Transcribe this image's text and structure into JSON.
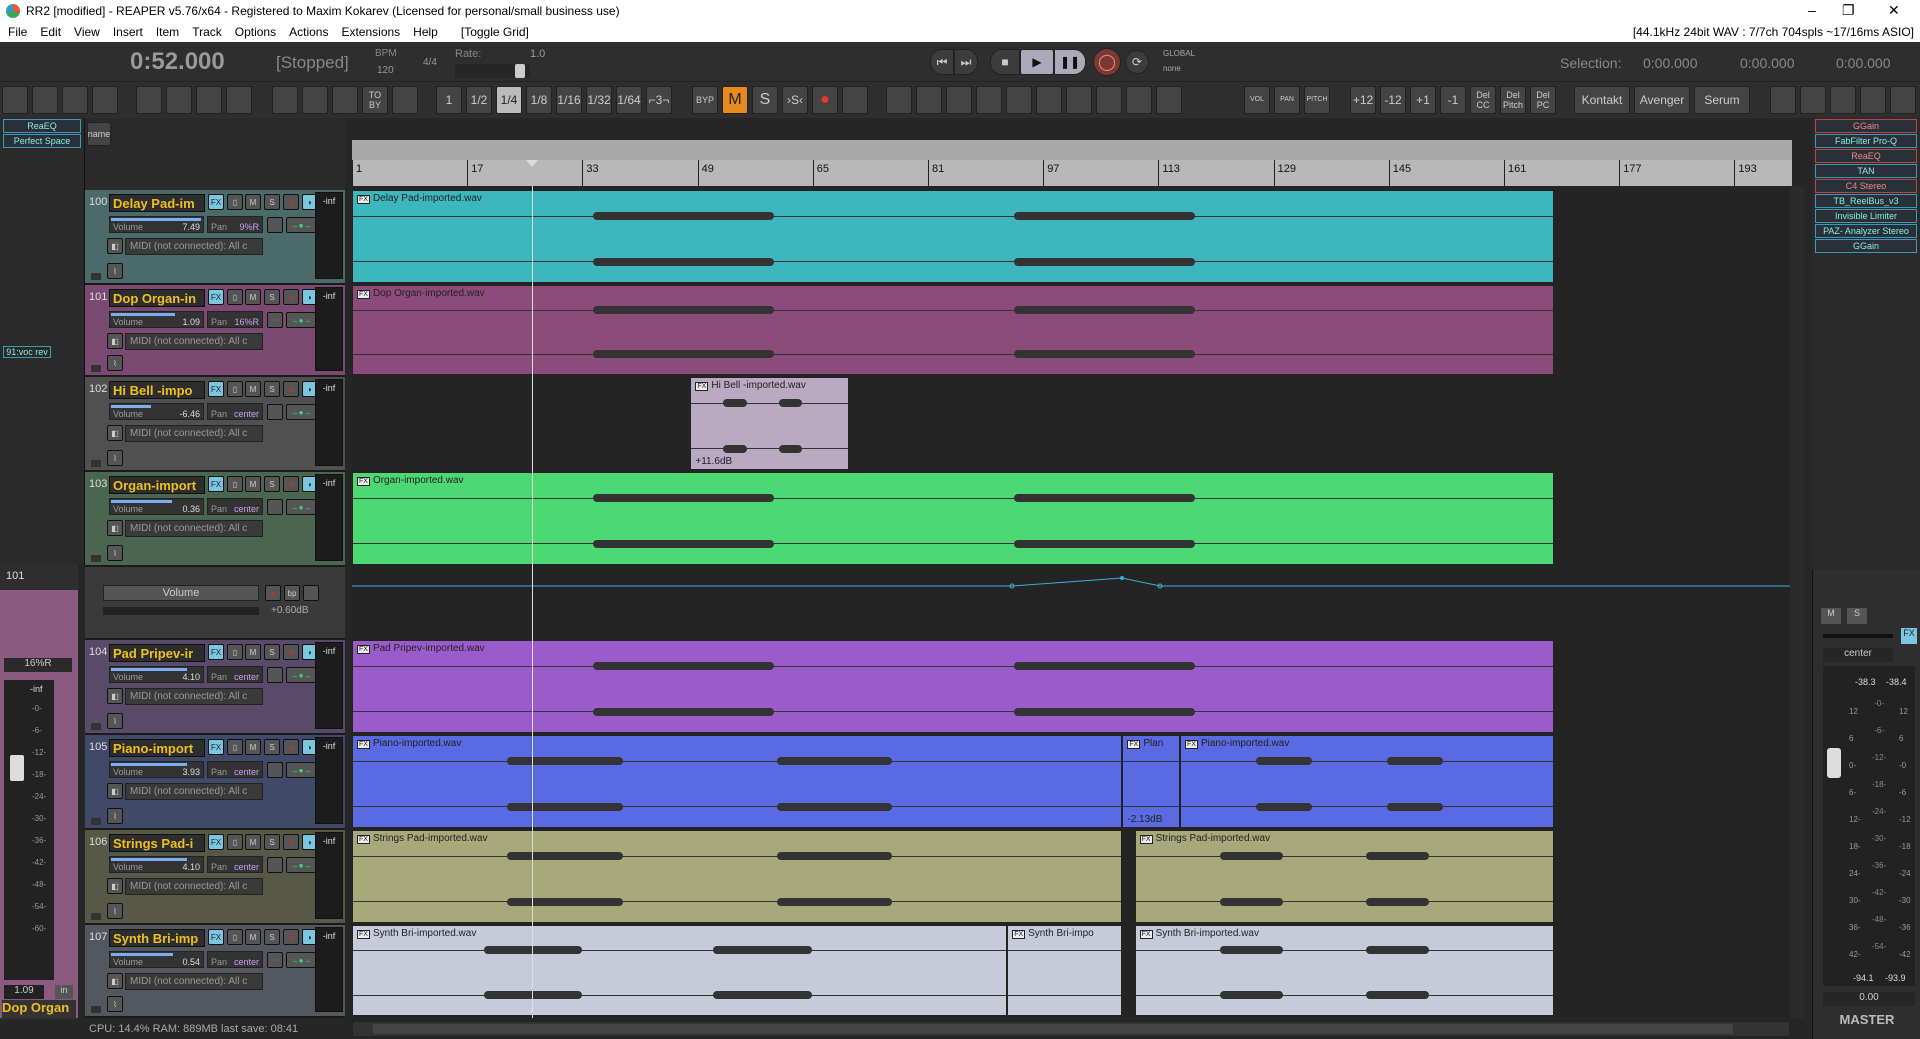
{
  "window": {
    "title": "RR2 [modified] - REAPER v5.76/x64 - Registered to Maxim Kokarev (Licensed for personal/small business use)",
    "minimize": "–",
    "maximize": "❐",
    "close": "✕",
    "format": "[44.1kHz 24bit WAV : 7/7ch 704spls ~17/16ms ASIO]"
  },
  "menu": [
    "File",
    "Edit",
    "View",
    "Insert",
    "Item",
    "Track",
    "Options",
    "Actions",
    "Extensions",
    "Help",
    "[Toggle Grid]"
  ],
  "transport": {
    "time": "0:52.000",
    "state": "[Stopped]",
    "bpm_label": "BPM",
    "bpm": "120",
    "timesig": "4/4",
    "rate_label": "Rate:",
    "rate": "1.0",
    "global_label": "GLOBAL",
    "global_value": "none",
    "selection_label": "Selection:",
    "sel_start": "0:00.000",
    "sel_end": "0:00.000",
    "sel_len": "0:00.000"
  },
  "toolbar": {
    "grid": [
      "1",
      "1/2",
      "1/4",
      "1/8",
      "1/16",
      "1/32",
      "1/64",
      "⌐3¬"
    ],
    "grid_active": "1/4",
    "byp": "BYP",
    "fx": "FX",
    "mute": "M",
    "solo": "S",
    "solo_x": "›S‹",
    "to_by": "TO BY",
    "vol": "VOL",
    "pan": "PAN",
    "pitch": "PITCH",
    "transpose": [
      "+12",
      "-12",
      "+1",
      "-1"
    ],
    "del": [
      "Del CC",
      "Del Pitch",
      "Del PC"
    ],
    "plugins": [
      "Kontakt",
      "Avenger",
      "Serum"
    ]
  },
  "left_fx": [
    "ReaEQ",
    "Perfect Space"
  ],
  "left_send": "91:voc rev",
  "tcp_header": {
    "name_btn": "name"
  },
  "ruler": [
    "1",
    "17",
    "33",
    "49",
    "65",
    "81",
    "97",
    "113",
    "129",
    "145",
    "161",
    "177",
    "193"
  ],
  "tracks": [
    {
      "num": "100",
      "name": "Delay Pad-im",
      "volume": "7.49",
      "pan": "9%R",
      "midi": "MIDI (not connected): All c",
      "meter": "-inf",
      "color": "#3db6bd",
      "tcp": "#4b6a6a",
      "items": [
        {
          "name": "Delay Pad-imported.wav",
          "start": 1,
          "end": 168
        }
      ]
    },
    {
      "num": "101",
      "name": "Dop Organ-in",
      "volume": "1.09",
      "pan": "16%R",
      "midi": "MIDI (not connected): All c",
      "meter": "-inf",
      "color": "#8b4c7b",
      "tcp": "#7a4a72",
      "items": [
        {
          "name": "Dop Organ-imported.wav",
          "start": 1,
          "end": 168
        }
      ]
    },
    {
      "num": "102",
      "name": "Hi Bell -impo",
      "volume": "-6.46",
      "pan": "center",
      "midi": "MIDI (not connected): All c",
      "meter": "-inf",
      "color": "#b9a9c2",
      "tcp": "#505050",
      "items": [
        {
          "name": "Hi Bell -imported.wav",
          "start": 48,
          "end": 70,
          "gain": "+11.6dB"
        }
      ]
    },
    {
      "num": "103",
      "name": "Organ-import",
      "volume": "0.36",
      "pan": "center",
      "midi": "MIDI (not connected): All c",
      "meter": "-inf",
      "color": "#4cd873",
      "tcp": "#4a6650",
      "items": [
        {
          "name": "Organ-imported.wav",
          "start": 1,
          "end": 168
        }
      ]
    },
    {
      "num": "104",
      "name": "Pad Pripev-ir",
      "volume": "4.10",
      "pan": "center",
      "midi": "MIDI (not connected): All c",
      "meter": "-inf",
      "color": "#9b5ccb",
      "tcp": "#584a68",
      "items": [
        {
          "name": "Pad Pripev-imported.wav",
          "start": 1,
          "end": 168
        }
      ]
    },
    {
      "num": "105",
      "name": "Piano-import",
      "volume": "3.93",
      "pan": "center",
      "midi": "MIDI (not connected): All c",
      "meter": "-inf",
      "color": "#5a6ae2",
      "tcp": "#404a68",
      "items": [
        {
          "name": "Piano-imported.wav",
          "start": 1,
          "end": 108
        },
        {
          "name": "Plan",
          "start": 108,
          "end": 116,
          "gain": "-2.13dB"
        },
        {
          "name": "Piano-imported.wav",
          "start": 116,
          "end": 168
        }
      ]
    },
    {
      "num": "106",
      "name": "Strings Pad-i",
      "volume": "4.10",
      "pan": "center",
      "midi": "MIDI (not connected): All c",
      "meter": "-inf",
      "color": "#a8a97a",
      "tcp": "#585846",
      "items": [
        {
          "name": "Strings Pad-imported.wav",
          "start": 1,
          "end": 108
        },
        {
          "name": "Strings Pad-imported.wav",
          "start": 109.7,
          "end": 168
        }
      ]
    },
    {
      "num": "107",
      "name": "Synth Bri-imp",
      "volume": "0.54",
      "pan": "center",
      "midi": "MIDI (not connected): All c",
      "meter": "-inf",
      "color": "#c6cad9",
      "tcp": "#535860",
      "items": [
        {
          "name": "Synth Bri-imported.wav",
          "start": 1,
          "end": 92
        },
        {
          "name": "Synth Bri-impo",
          "start": 92,
          "end": 108
        },
        {
          "name": "Synth Bri-imported.wav",
          "start": 109.7,
          "end": 168
        }
      ]
    }
  ],
  "envelope": {
    "name": "Volume",
    "arm": "●",
    "bp": "bp",
    "value": "+0.60dB"
  },
  "left_mixer": {
    "track": "101",
    "pan": "16%R",
    "meter": "-inf",
    "scale": [
      "-0-",
      "-6-",
      "-12-",
      "-18-",
      "-24-",
      "-30-",
      "-36-",
      "-42-",
      "-48-",
      "-54-",
      "-60-"
    ],
    "volume": "1.09",
    "in": "in",
    "name": "Dop Organ"
  },
  "right_fx": [
    {
      "name": "GGain",
      "state": "offline"
    },
    {
      "name": "FabFilter Pro-Q",
      "state": "on"
    },
    {
      "name": "ReaEQ",
      "state": "offline"
    },
    {
      "name": "TAN",
      "state": "on"
    },
    {
      "name": "C4 Stereo",
      "state": "offline"
    },
    {
      "name": "TB_ReelBus_v3",
      "state": "on"
    },
    {
      "name": "Invisible Limiter",
      "state": "on"
    },
    {
      "name": "PAZ- Analyzer Stereo",
      "state": "on"
    },
    {
      "name": "GGain",
      "state": "on"
    }
  ],
  "master": {
    "m": "M",
    "s": "S",
    "fx": "FX",
    "pan": "center",
    "peak_l": "-38.3",
    "peak_r": "-38.4",
    "scale_l": [
      "12",
      "6",
      "0-",
      "6-",
      "12-",
      "18-",
      "24-",
      "30-",
      "36-",
      "42-"
    ],
    "scale_mid": [
      "-0-",
      "-6-",
      "-12-",
      "-18-",
      "-24-",
      "-30-",
      "-36-",
      "-42-",
      "-48-",
      "-54-"
    ],
    "scale_r": [
      "12",
      "6",
      "-0",
      "-6",
      "-12",
      "-18",
      "-24",
      "-30",
      "-36",
      "-42"
    ],
    "rms_l": "-94.1",
    "rms_r": "-93.9",
    "volume": "0.00",
    "label": "MASTER"
  },
  "status": "CPU: 14.4%  RAM: 889MB  last save: 08:41",
  "playhead_bar": 26,
  "colors": {
    "bg": "#262626",
    "offline_fx": "#b44444",
    "online_fx": "#3a9ab8",
    "track_name": "#f0c020"
  }
}
